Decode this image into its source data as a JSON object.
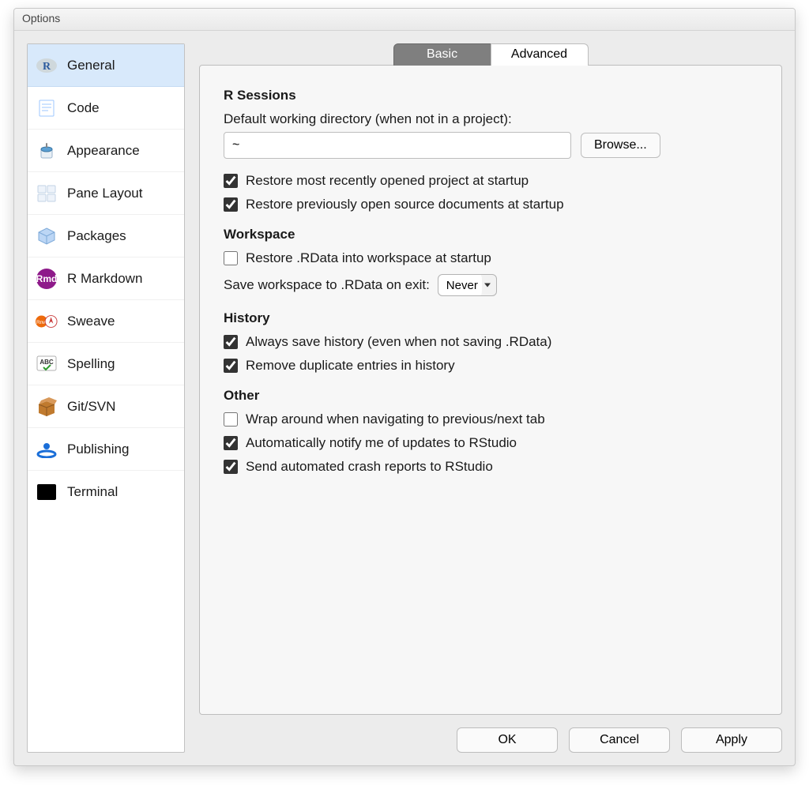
{
  "window": {
    "title": "Options"
  },
  "sidebar": {
    "items": [
      {
        "label": "General"
      },
      {
        "label": "Code"
      },
      {
        "label": "Appearance"
      },
      {
        "label": "Pane Layout"
      },
      {
        "label": "Packages"
      },
      {
        "label": "R Markdown"
      },
      {
        "label": "Sweave"
      },
      {
        "label": "Spelling"
      },
      {
        "label": "Git/SVN"
      },
      {
        "label": "Publishing"
      },
      {
        "label": "Terminal"
      }
    ],
    "selected_index": 0
  },
  "tabs": {
    "active": "Basic",
    "inactive": "Advanced"
  },
  "sections": {
    "r_sessions": {
      "header": "R Sessions",
      "working_dir_label": "Default working directory (when not in a project):",
      "working_dir_value": "~",
      "browse_label": "Browse...",
      "restore_project": {
        "label": "Restore most recently opened project at startup",
        "checked": true
      },
      "restore_docs": {
        "label": "Restore previously open source documents at startup",
        "checked": true
      }
    },
    "workspace": {
      "header": "Workspace",
      "restore_rdata": {
        "label": "Restore .RData into workspace at startup",
        "checked": false
      },
      "save_rdata_label": "Save workspace to .RData on exit:",
      "save_rdata_value": "Never"
    },
    "history": {
      "header": "History",
      "always_save": {
        "label": "Always save history (even when not saving .RData)",
        "checked": true
      },
      "remove_dupes": {
        "label": "Remove duplicate entries in history",
        "checked": true
      }
    },
    "other": {
      "header": "Other",
      "wrap_tabs": {
        "label": "Wrap around when navigating to previous/next tab",
        "checked": false
      },
      "notify_updates": {
        "label": "Automatically notify me of updates to RStudio",
        "checked": true
      },
      "crash_reports": {
        "label": "Send automated crash reports to RStudio",
        "checked": true
      }
    }
  },
  "buttons": {
    "ok": "OK",
    "cancel": "Cancel",
    "apply": "Apply"
  }
}
